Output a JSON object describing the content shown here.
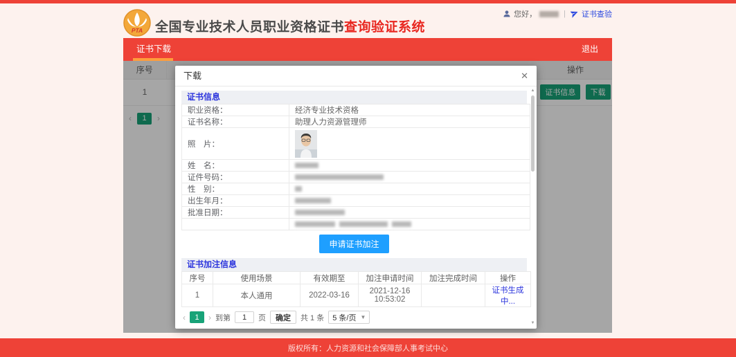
{
  "header": {
    "logo_text": "PTA",
    "title_main": "全国专业技术人员职业资格证书",
    "title_accent": "查询验证系统",
    "greeting": "您好，",
    "separator": "|",
    "cert_verify_link": "证书查验"
  },
  "nav": {
    "tab_download": "证书下载",
    "logout": "退出"
  },
  "bg_table": {
    "col_index": "序号",
    "col_action": "操作",
    "row_index": "1",
    "cert_info_btn": "证书信息",
    "download_btn": "下载",
    "active_page": "1"
  },
  "modal": {
    "title": "下载",
    "close": "✕",
    "section_cert_info": "证书信息",
    "fields": [
      {
        "label": "职业资格：",
        "value": "经济专业技术资格"
      },
      {
        "label": "证书名称：",
        "value": "助理人力资源管理师"
      },
      {
        "label": "照　片："
      },
      {
        "label": "姓　名："
      },
      {
        "label": "证件号码："
      },
      {
        "label": "性　别："
      },
      {
        "label": "出生年月："
      },
      {
        "label": "批准日期："
      },
      {
        "label": ""
      }
    ],
    "apply_btn": "申请证书加注",
    "section_annotation": "证书加注信息",
    "annotation_table": {
      "headers": [
        "序号",
        "使用场景",
        "有效期至",
        "加注申请时间",
        "加注完成时间",
        "操作"
      ],
      "row": {
        "index": "1",
        "scene": "本人通用",
        "valid_until": "2022-03-16",
        "apply_time": "2021-12-16 10:53:02",
        "complete_time": "",
        "action": "证书生成中..."
      }
    },
    "pagination": {
      "active_page": "1",
      "goto_label": "到第",
      "page_input_value": "1",
      "page_unit": "页",
      "confirm_btn": "确定",
      "total_label": "共 1 条",
      "page_size": "5 条/页"
    }
  },
  "footer": {
    "copyright": "版权所有：人力资源和社会保障部人事考试中心"
  },
  "colors": {
    "brand_red": "#ee4237",
    "title_accent_red": "#e8261f",
    "nav_indicator_orange": "#ff9d3c",
    "primary_button_blue": "#1E9FFF",
    "section_heading_blue": "#2c35dd",
    "pagination_teal": "#18a378"
  }
}
